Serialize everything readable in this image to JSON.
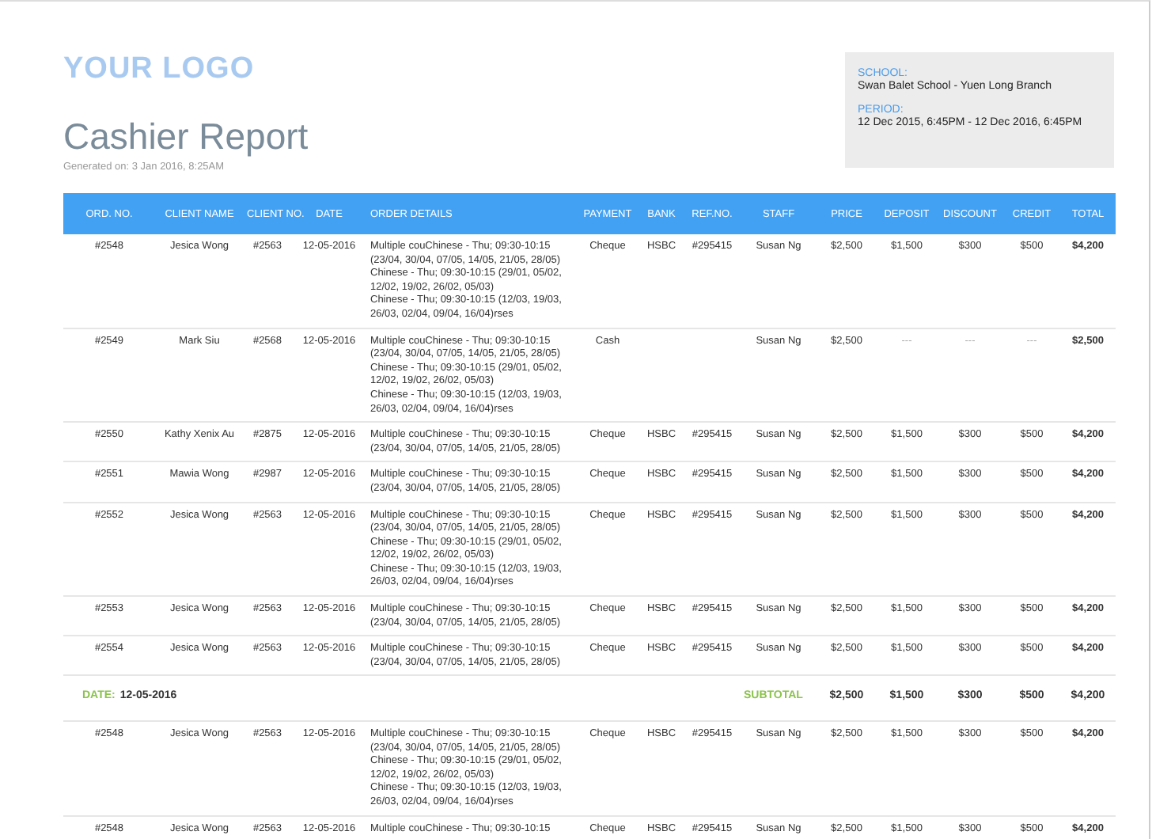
{
  "logo": "YOUR LOGO",
  "title": "Cashier Report",
  "generated": "Generated on: 3 Jan 2016, 8:25AM",
  "info": [
    {
      "label": "SCHOOL:",
      "value": "Swan Balet School - Yuen Long Branch"
    },
    {
      "label": "PERIOD:",
      "value": "12 Dec 2015, 6:45PM - 12 Dec 2016, 6:45PM"
    }
  ],
  "table": {
    "columns": [
      "ORD. NO.",
      "CLIENT NAME",
      "CLIENT NO.",
      "DATE",
      "ORDER DETAILS",
      "PAYMENT",
      "BANK",
      "REF.NO.",
      "STAFF",
      "PRICE",
      "DEPOSIT",
      "DISCOUNT",
      "CREDIT",
      "TOTAL"
    ],
    "rows": [
      {
        "kind": "order",
        "cells": [
          "#2548",
          "Jesica Wong",
          "#2563",
          "12-05-2016",
          "Multiple couChinese - Thu; 09:30-10:15 (23/04, 30/04, 07/05, 14/05, 21/05, 28/05)\nChinese - Thu; 09:30-10:15 (29/01, 05/02, 12/02, 19/02, 26/02, 05/03)\nChinese - Thu; 09:30-10:15 (12/03, 19/03, 26/03, 02/04, 09/04, 16/04)rses",
          "Cheque",
          "HSBC",
          "#295415",
          "Susan Ng",
          "$2,500",
          "$1,500",
          "$300",
          "$500",
          "$4,200"
        ]
      },
      {
        "kind": "order",
        "cells": [
          "#2549",
          "Mark Siu",
          "#2568",
          "12-05-2016",
          "Multiple couChinese - Thu; 09:30-10:15 (23/04, 30/04, 07/05, 14/05, 21/05, 28/05)\nChinese - Thu; 09:30-10:15 (29/01, 05/02, 12/02, 19/02, 26/02, 05/03)\nChinese - Thu; 09:30-10:15 (12/03, 19/03, 26/03, 02/04, 09/04, 16/04)rses",
          "Cash",
          "",
          "",
          "Susan Ng",
          "$2,500",
          "---",
          "---",
          "---",
          "$2,500"
        ]
      },
      {
        "kind": "order",
        "cells": [
          "#2550",
          "Kathy Xenix Au",
          "#2875",
          "12-05-2016",
          "Multiple couChinese - Thu; 09:30-10:15 (23/04, 30/04, 07/05, 14/05, 21/05, 28/05)",
          "Cheque",
          "HSBC",
          "#295415",
          "Susan Ng",
          "$2,500",
          "$1,500",
          "$300",
          "$500",
          "$4,200"
        ]
      },
      {
        "kind": "order",
        "cells": [
          "#2551",
          "Mawia Wong",
          "#2987",
          "12-05-2016",
          "Multiple couChinese - Thu; 09:30-10:15 (23/04, 30/04, 07/05, 14/05, 21/05, 28/05)",
          "Cheque",
          "HSBC",
          "#295415",
          "Susan Ng",
          "$2,500",
          "$1,500",
          "$300",
          "$500",
          "$4,200"
        ]
      },
      {
        "kind": "order",
        "cells": [
          "#2552",
          "Jesica Wong",
          "#2563",
          "12-05-2016",
          "Multiple couChinese - Thu; 09:30-10:15 (23/04, 30/04, 07/05, 14/05, 21/05, 28/05)\nChinese - Thu; 09:30-10:15 (29/01, 05/02, 12/02, 19/02, 26/02, 05/03)\nChinese - Thu; 09:30-10:15 (12/03, 19/03, 26/03, 02/04, 09/04, 16/04)rses",
          "Cheque",
          "HSBC",
          "#295415",
          "Susan Ng",
          "$2,500",
          "$1,500",
          "$300",
          "$500",
          "$4,200"
        ]
      },
      {
        "kind": "order",
        "cells": [
          "#2553",
          "Jesica Wong",
          "#2563",
          "12-05-2016",
          "Multiple couChinese - Thu; 09:30-10:15 (23/04, 30/04, 07/05, 14/05, 21/05, 28/05)",
          "Cheque",
          "HSBC",
          "#295415",
          "Susan Ng",
          "$2,500",
          "$1,500",
          "$300",
          "$500",
          "$4,200"
        ]
      },
      {
        "kind": "order",
        "cells": [
          "#2554",
          "Jesica Wong",
          "#2563",
          "12-05-2016",
          "Multiple couChinese - Thu; 09:30-10:15 (23/04, 30/04, 07/05, 14/05, 21/05, 28/05)",
          "Cheque",
          "HSBC",
          "#295415",
          "Susan Ng",
          "$2,500",
          "$1,500",
          "$300",
          "$500",
          "$4,200"
        ]
      },
      {
        "kind": "subtotal",
        "date_label": "DATE:",
        "date": "12-05-2016",
        "cells": [
          "",
          "",
          "",
          "",
          "",
          "",
          "",
          "",
          "SUBTOTAL",
          "$2,500",
          "$1,500",
          "$300",
          "$500",
          "$4,200"
        ]
      },
      {
        "kind": "order",
        "cells": [
          "#2548",
          "Jesica Wong",
          "#2563",
          "12-05-2016",
          "Multiple couChinese - Thu; 09:30-10:15 (23/04, 30/04, 07/05, 14/05, 21/05, 28/05)\nChinese - Thu; 09:30-10:15 (29/01, 05/02, 12/02, 19/02, 26/02, 05/03)\nChinese - Thu; 09:30-10:15 (12/03, 19/03, 26/03, 02/04, 09/04, 16/04)rses",
          "Cheque",
          "HSBC",
          "#295415",
          "Susan Ng",
          "$2,500",
          "$1,500",
          "$300",
          "$500",
          "$4,200"
        ]
      },
      {
        "kind": "order",
        "cells": [
          "#2548",
          "Jesica Wong",
          "#2563",
          "12-05-2016",
          "Multiple couChinese - Thu; 09:30-10:15",
          "Cheque",
          "HSBC",
          "#295415",
          "Susan Ng",
          "$2,500",
          "$1,500",
          "$300",
          "$500",
          "$4,200"
        ]
      }
    ]
  }
}
